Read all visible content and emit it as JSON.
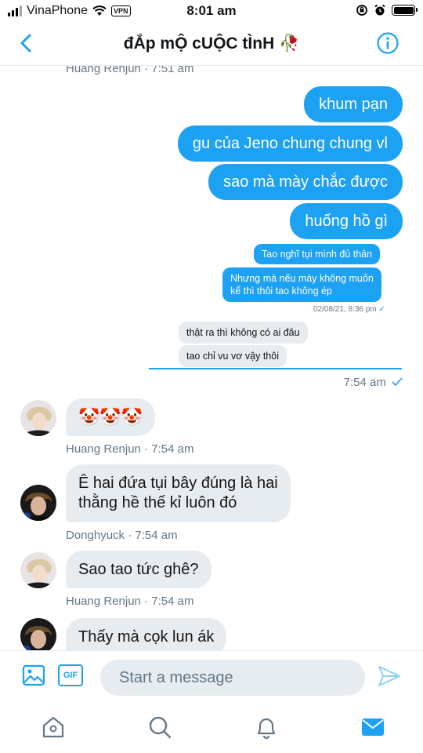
{
  "status_bar": {
    "carrier": "VinaPhone",
    "vpn": "VPN",
    "time": "8:01 am"
  },
  "header": {
    "title": "đẮp mỘ cUỘC tÌnH",
    "title_emoji": "🥀"
  },
  "messages": {
    "top_meta": "Huang Renjun · 7:51 am",
    "outgoing": [
      "khum pạn",
      "gu của Jeno  chung chung vl",
      "sao mà mày chắc được",
      "huống hồ gì"
    ],
    "quoted_out": [
      "Tao nghĩ tụi mình đủ thân",
      "Nhưng mà nếu mày không muốn",
      "kể thì thôi tao không ép"
    ],
    "quoted_out_stamp": "02/08/21, 8:36 pm",
    "quoted_in": [
      "thật ra thì không có ai đâu",
      "tao chỉ vu vơ vậy thôi"
    ],
    "outgoing_stamp": "7:54 am",
    "incoming": [
      {
        "sender": "renjun",
        "text": "🤡🤡🤡",
        "meta": "Huang Renjun · 7:54 am"
      },
      {
        "sender": "donghyuck",
        "lines": [
          "Ê hai đứa tụi bây đúng là hai",
          "thằng hề thế kỉ luôn đó"
        ],
        "meta": "Donghyuck · 7:54 am"
      },
      {
        "sender": "renjun",
        "text": "Sao tao tức ghê?",
        "meta": "Huang Renjun · 7:54 am"
      },
      {
        "sender": "donghyuck",
        "text": "Thấy mà cọk lun ák"
      }
    ]
  },
  "composer": {
    "placeholder": "Start a message",
    "gif_label": "GIF"
  },
  "colors": {
    "accent": "#1da1f2",
    "bubble_in": "#e6ecf0",
    "muted": "#657786"
  }
}
